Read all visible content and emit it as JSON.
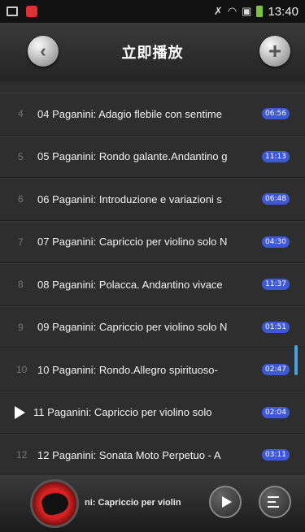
{
  "status_bar": {
    "time": "13:40"
  },
  "header": {
    "title": "立即播放"
  },
  "tracks": [
    {
      "index": "4",
      "title": "04 Paganini: Adagio flebile con sentime",
      "duration": "06:56"
    },
    {
      "index": "5",
      "title": "05 Paganini: Rondo galante.Andantino g",
      "duration": "11:13"
    },
    {
      "index": "6",
      "title": "06 Paganini: Introduzione e variazioni s",
      "duration": "06:48"
    },
    {
      "index": "7",
      "title": "07 Paganini: Capriccio per violino solo N",
      "duration": "04:30"
    },
    {
      "index": "8",
      "title": "08 Paganini: Polacca. Andantino vivace",
      "duration": "11:37"
    },
    {
      "index": "9",
      "title": "09 Paganini: Capriccio per violino solo N",
      "duration": "01:51"
    },
    {
      "index": "10",
      "title": "10 Paganini: Rondo.Allegro spirituoso-",
      "duration": "02:47"
    },
    {
      "index": "",
      "title": "11 Paganini: Capriccio per violino solo",
      "duration": "02:04",
      "playing": true
    },
    {
      "index": "12",
      "title": "12 Paganini: Sonata Moto Perpetuo - A",
      "duration": "03:11"
    }
  ],
  "player": {
    "now_playing": "ni: Capriccio per violin"
  },
  "colors": {
    "accent": "#3f58d6",
    "scrollbar": "#4aa3e0"
  },
  "icons": {
    "back": "back-arrow-icon",
    "add": "plus-icon",
    "play": "play-icon",
    "playlist": "playlist-icon"
  }
}
